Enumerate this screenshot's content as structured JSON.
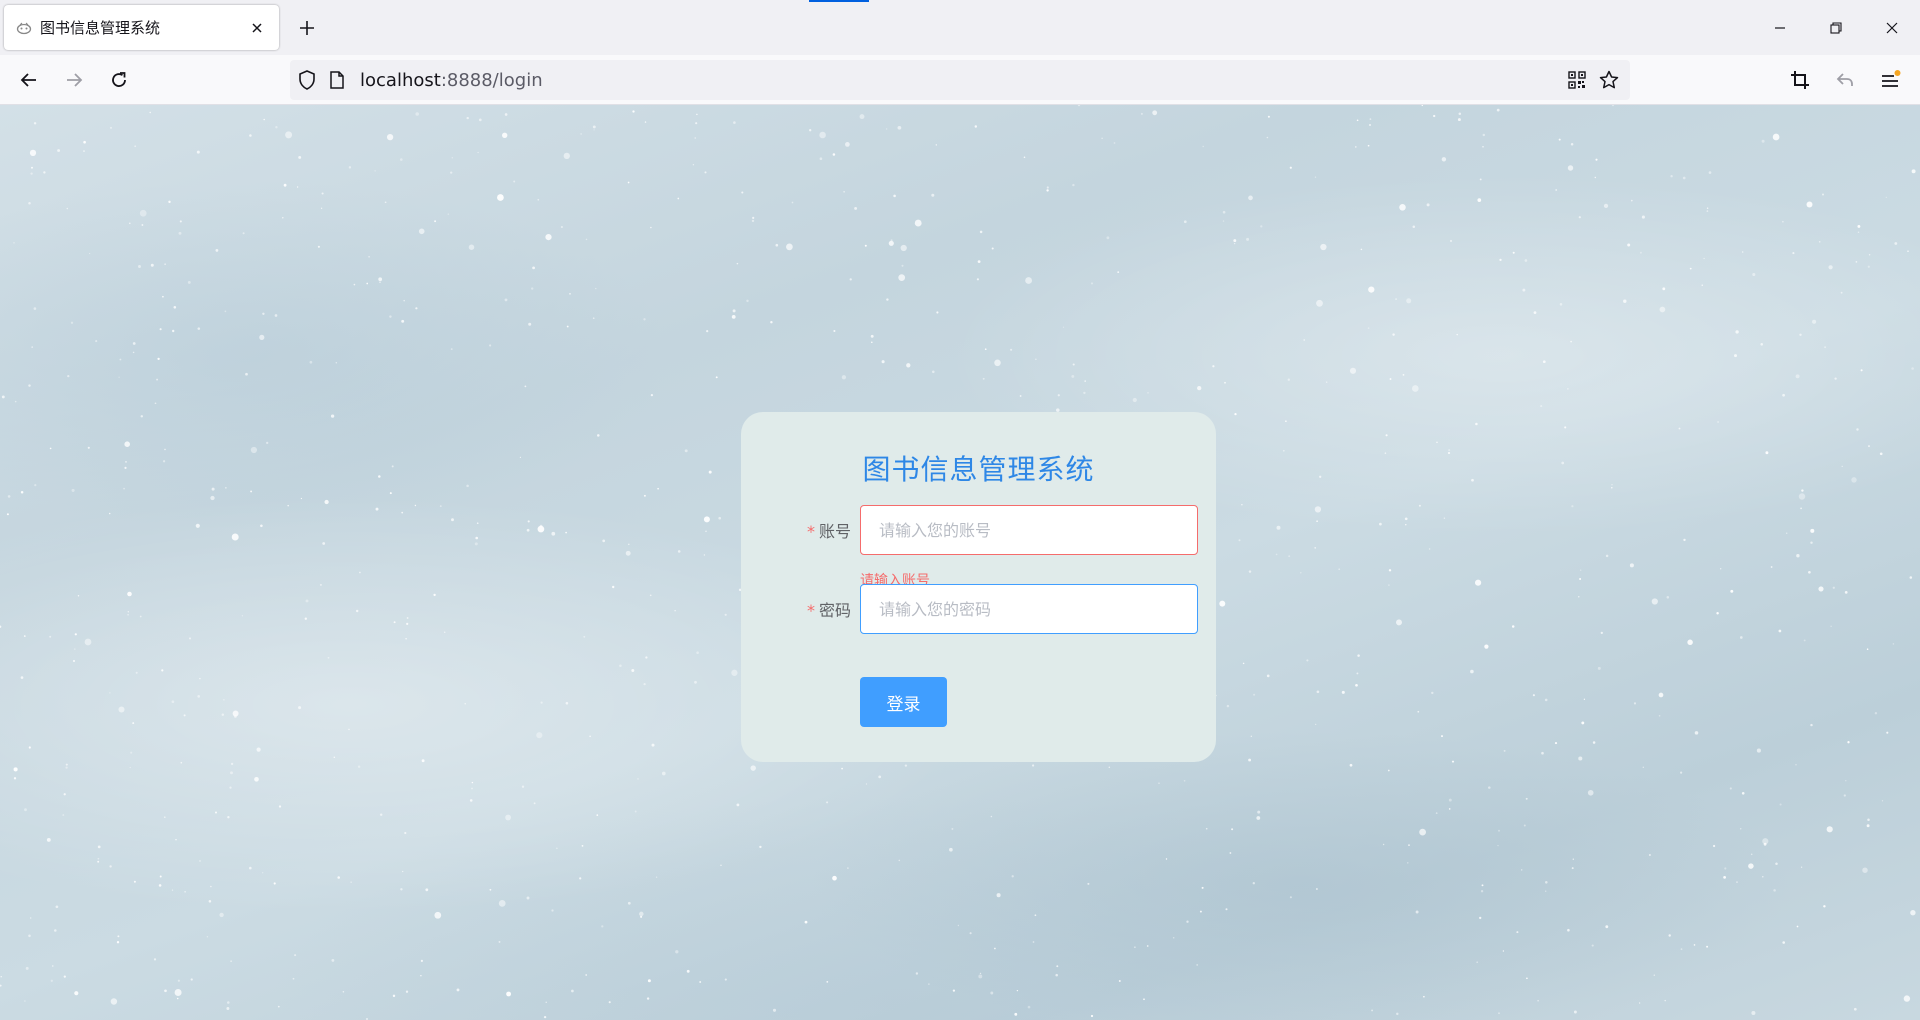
{
  "browser": {
    "tab": {
      "title": "图书信息管理系统",
      "favicon": "vue-app-icon"
    },
    "url": {
      "host": "localhost",
      "rest": ":8888/login"
    },
    "colors": {
      "accent": "#0060df"
    }
  },
  "login": {
    "title": "图书信息管理系统",
    "required_mark": "*",
    "account": {
      "label": "账号",
      "placeholder": "请输入您的账号",
      "value": "",
      "error": "请输入账号"
    },
    "password": {
      "label": "密码",
      "placeholder": "请输入您的密码",
      "value": ""
    },
    "submit_label": "登录",
    "colors": {
      "title": "#2e87e6",
      "primary": "#409eff",
      "error": "#f56c6c",
      "card_bg": "#e0ebea"
    }
  }
}
